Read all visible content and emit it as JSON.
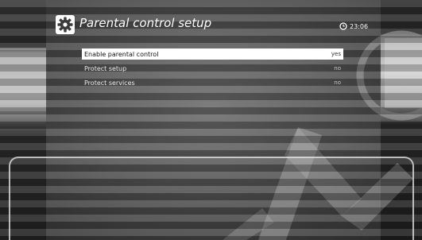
{
  "header": {
    "icon": "gear-icon",
    "title": "Parental control setup",
    "clock_icon": "clock-icon",
    "time": "23:06"
  },
  "menu": {
    "items": [
      {
        "label": "Enable parental control",
        "value": "yes",
        "selected": true
      },
      {
        "label": "Protect setup",
        "value": "no",
        "selected": false
      },
      {
        "label": "Protect services",
        "value": "no",
        "selected": false
      }
    ]
  },
  "colors": {
    "highlight": "#ffffff",
    "text": "#ffffff",
    "background": "#5a5a5a"
  }
}
